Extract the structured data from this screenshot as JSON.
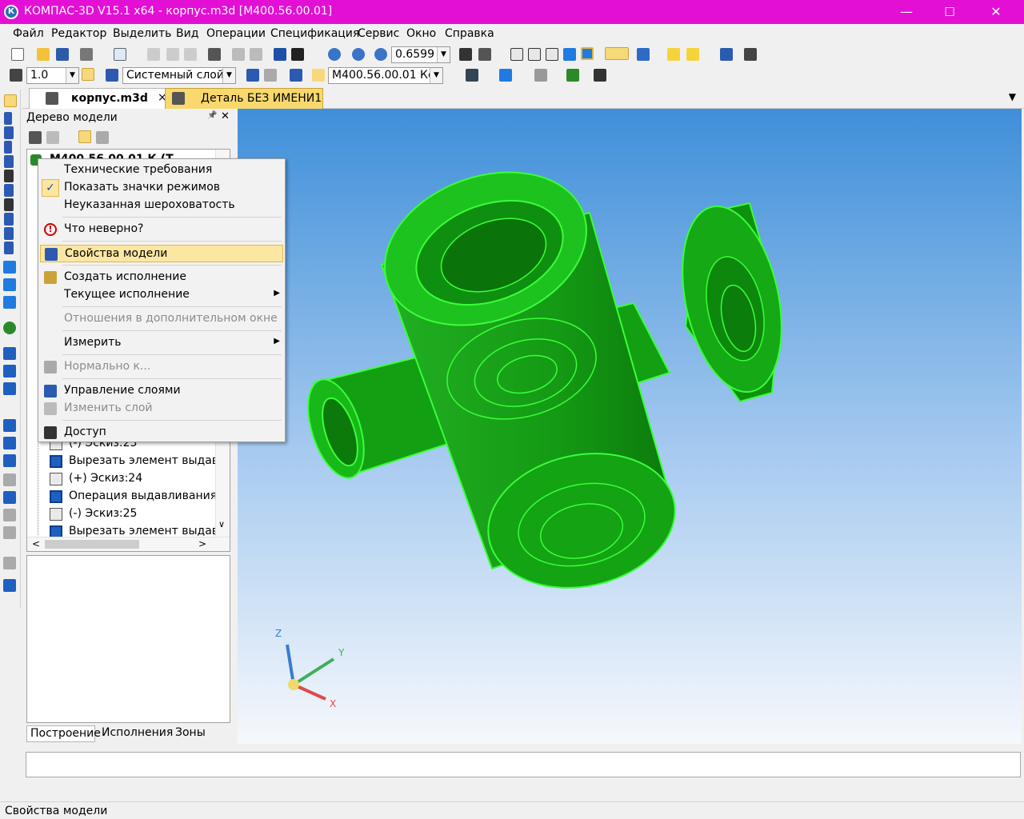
{
  "window": {
    "title": "КОМПАС-3D V15.1 x64 - корпус.m3d [М400.56.00.01]",
    "logo": "К",
    "min": "—",
    "max": "☐",
    "close": "✕"
  },
  "menu": [
    "Файл",
    "Редактор",
    "Выделить",
    "Вид",
    "Операции",
    "Спецификация",
    "Сервис",
    "Окно",
    "Справка"
  ],
  "toolbar1": {
    "zoom_value": "0.6599"
  },
  "toolbar2": {
    "step_value": "1.0",
    "layer": "Системный слой",
    "designation": "М400.56.00.01 Кс"
  },
  "tabs": [
    {
      "label": "корпус.m3d",
      "close": "×"
    },
    {
      "label": "Деталь БЕЗ ИМЕНИ1"
    }
  ],
  "tabs_overflow": "▼",
  "panel": {
    "title": "Дерево модели",
    "pin": "📌",
    "close": "✕",
    "root_partial": "М400.56.00.01 К  (Т"
  },
  "tree_items": [
    {
      "label": "(-) Эскиз:23",
      "icon": "sketch"
    },
    {
      "label": "Вырезать элемент выдав/",
      "icon": "cut"
    },
    {
      "label": "(+) Эскиз:24",
      "icon": "sketch"
    },
    {
      "label": "Операция выдавливания",
      "icon": "extrude"
    },
    {
      "label": "(-) Эскиз:25",
      "icon": "sketch"
    },
    {
      "label": "Вырезать элемент выдав/",
      "icon": "cut"
    }
  ],
  "bottom_tabs": [
    "Построение",
    "Исполнения",
    "Зоны"
  ],
  "context_menu": [
    {
      "label": "Технические требования",
      "state": "normal"
    },
    {
      "label": "Показать значки режимов",
      "state": "checked",
      "check": "✓"
    },
    {
      "label": "Неуказанная шероховатость",
      "state": "normal"
    },
    {
      "sep": true
    },
    {
      "label": "Что неверно?",
      "state": "normal",
      "icon": "warning-icon",
      "glyph": "!"
    },
    {
      "sep": true
    },
    {
      "label": "Свойства модели",
      "state": "highlight",
      "icon": "properties-icon"
    },
    {
      "sep": true
    },
    {
      "label": "Создать исполнение",
      "state": "normal",
      "icon": "variant-icon"
    },
    {
      "label": "Текущее исполнение",
      "state": "submenu",
      "arrow": "▶"
    },
    {
      "sep": true
    },
    {
      "label": "Отношения в дополнительном окне",
      "state": "disabled"
    },
    {
      "sep": true
    },
    {
      "label": "Измерить",
      "state": "submenu",
      "arrow": "▶"
    },
    {
      "sep": true
    },
    {
      "label": "Нормально к...",
      "state": "disabled",
      "icon": "normal-to-icon"
    },
    {
      "sep": true
    },
    {
      "label": "Управление слоями",
      "state": "normal",
      "icon": "layers-icon"
    },
    {
      "label": "Изменить слой",
      "state": "disabled",
      "icon": "change-layer-icon"
    },
    {
      "sep": true
    },
    {
      "label": "Доступ",
      "state": "normal",
      "icon": "access-icon"
    }
  ],
  "axes": {
    "x": "X",
    "y": "Y",
    "z": "Z"
  },
  "status_text": "Свойства модели",
  "colors": {
    "titlebar": "#e40fd5",
    "model": "#10a010",
    "edges": "#39ff39",
    "highlight": "#fbe6a2"
  }
}
